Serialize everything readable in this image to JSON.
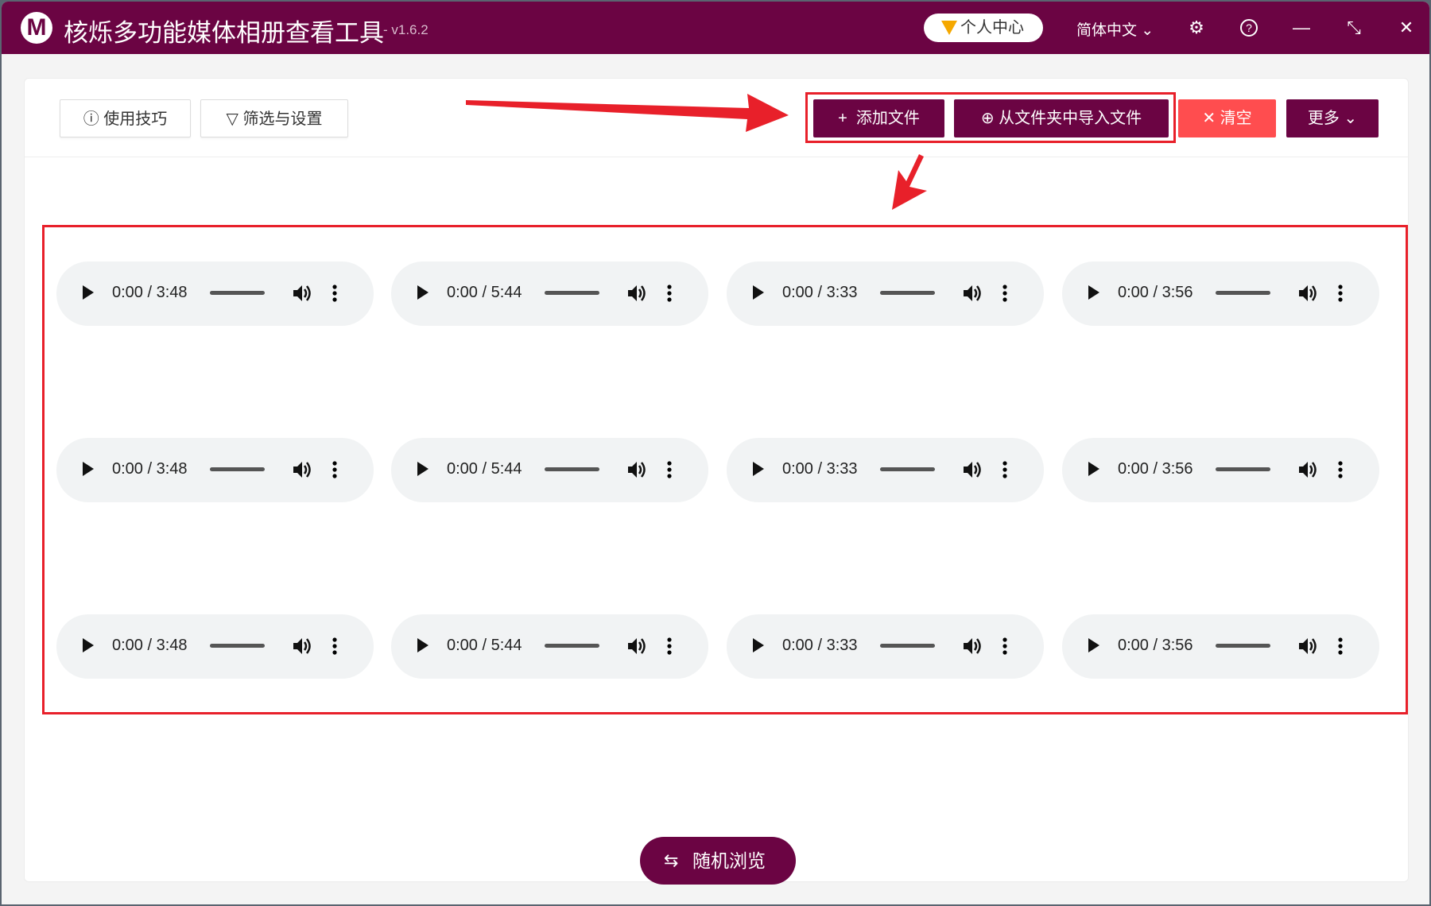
{
  "titlebar": {
    "logo_letter": "M",
    "title": "核烁多功能媒体相册查看工具",
    "version": "- v1.6.2",
    "user_center": "个人中心",
    "language": "简体中文",
    "icons": [
      "settings-icon",
      "help-icon",
      "minimize-icon",
      "maximize-icon",
      "close-icon"
    ]
  },
  "toolbar": {
    "tips": "使用技巧",
    "filter": "筛选与设置",
    "add_file": "添加文件",
    "import_folder": "从文件夹中导入文件",
    "clear": "清空",
    "more": "更多"
  },
  "players": [
    {
      "time": "0:00 / 3:48"
    },
    {
      "time": "0:00 / 5:44"
    },
    {
      "time": "0:00 / 3:33"
    },
    {
      "time": "0:00 / 3:56"
    },
    {
      "time": "0:00 / 3:48"
    },
    {
      "time": "0:00 / 5:44"
    },
    {
      "time": "0:00 / 3:33"
    },
    {
      "time": "0:00 / 3:56"
    },
    {
      "time": "0:00 / 3:48"
    },
    {
      "time": "0:00 / 5:44"
    },
    {
      "time": "0:00 / 3:33"
    },
    {
      "time": "0:00 / 3:56"
    }
  ],
  "random_browse": "随机浏览",
  "colors": {
    "brand": "#6b0443",
    "danger": "#ff4d4f",
    "annotation": "#e8202a"
  }
}
